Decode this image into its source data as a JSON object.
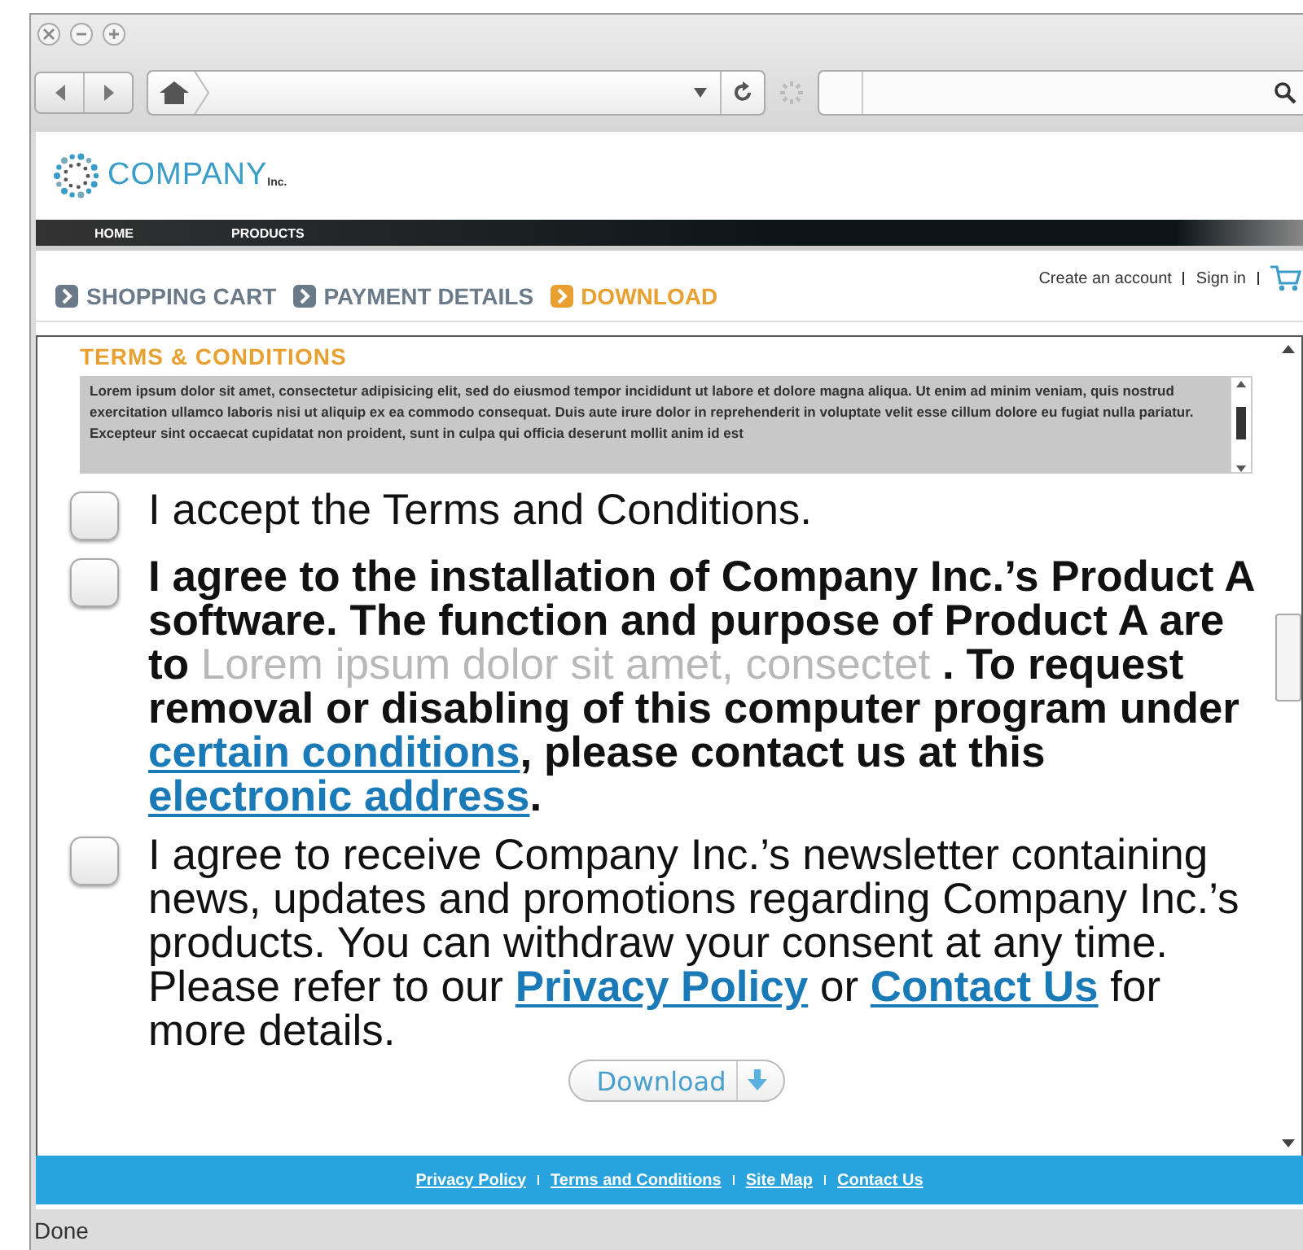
{
  "window": {
    "buttons": [
      {
        "kind": "close"
      },
      {
        "kind": "minimize"
      },
      {
        "kind": "zoom"
      }
    ]
  },
  "logo": {
    "name": "COMPANY",
    "suffix": "Inc."
  },
  "nav": [
    "HOME",
    "PRODUCTS"
  ],
  "steps": [
    {
      "label": "SHOPPING CART",
      "selected": false
    },
    {
      "label": "PAYMENT DETAILS",
      "selected": false
    },
    {
      "label": "DOWNLOAD",
      "selected": true
    }
  ],
  "account_links": [
    "Create an account",
    "Sign in"
  ],
  "terms": {
    "title": "TERMS & CONDITIONS",
    "text": "Lorem ipsum dolor sit amet, consectetur adipisicing elit, sed do eiusmod tempor incididunt ut labore et dolore magna aliqua. Ut enim ad minim veniam, quis nostrud exercitation ullamco laboris nisi ut aliquip ex ea commodo consequat. Duis aute irure dolor in reprehenderit in voluptate velit esse cillum dolore eu fugiat nulla pariatur. Excepteur sint occaecat cupidatat non proident, sunt in culpa qui officia deserunt mollit anim id est"
  },
  "agreements": [
    {
      "checked": false,
      "bold": false,
      "segments": [
        {
          "kind": "plain",
          "text": "I accept the Terms and Conditions."
        }
      ]
    },
    {
      "checked": false,
      "bold": true,
      "segments": [
        {
          "kind": "plain",
          "text": "I agree to the installation of Company Inc.’s Product A software. The function and purpose of Product A are to "
        },
        {
          "kind": "blurred",
          "text": "Lorem ipsum dolor sit amet, consectet"
        },
        {
          "kind": "plain",
          "text": " . To request removal or disabling of this computer program under "
        },
        {
          "kind": "link",
          "text": "certain conditions"
        },
        {
          "kind": "plain",
          "text": ", please contact us at this "
        },
        {
          "kind": "link",
          "text": "electronic address"
        },
        {
          "kind": "plain",
          "text": "."
        }
      ]
    },
    {
      "checked": false,
      "bold": false,
      "segments": [
        {
          "kind": "plain",
          "text": "I agree to receive Company Inc.’s newsletter containing news, updates and promotions regarding Company Inc.’s products. You can withdraw your consent at any time. Please refer to our "
        },
        {
          "kind": "boldlink",
          "text": "Privacy Policy"
        },
        {
          "kind": "plain",
          "text": " or "
        },
        {
          "kind": "boldlink",
          "text": "Contact Us"
        },
        {
          "kind": "plain",
          "text": " for more details."
        }
      ]
    }
  ],
  "download_button": "Download",
  "footer_links": [
    "Privacy Policy",
    "Terms and Conditions",
    "Site Map",
    "Contact Us"
  ],
  "status": "Done"
}
